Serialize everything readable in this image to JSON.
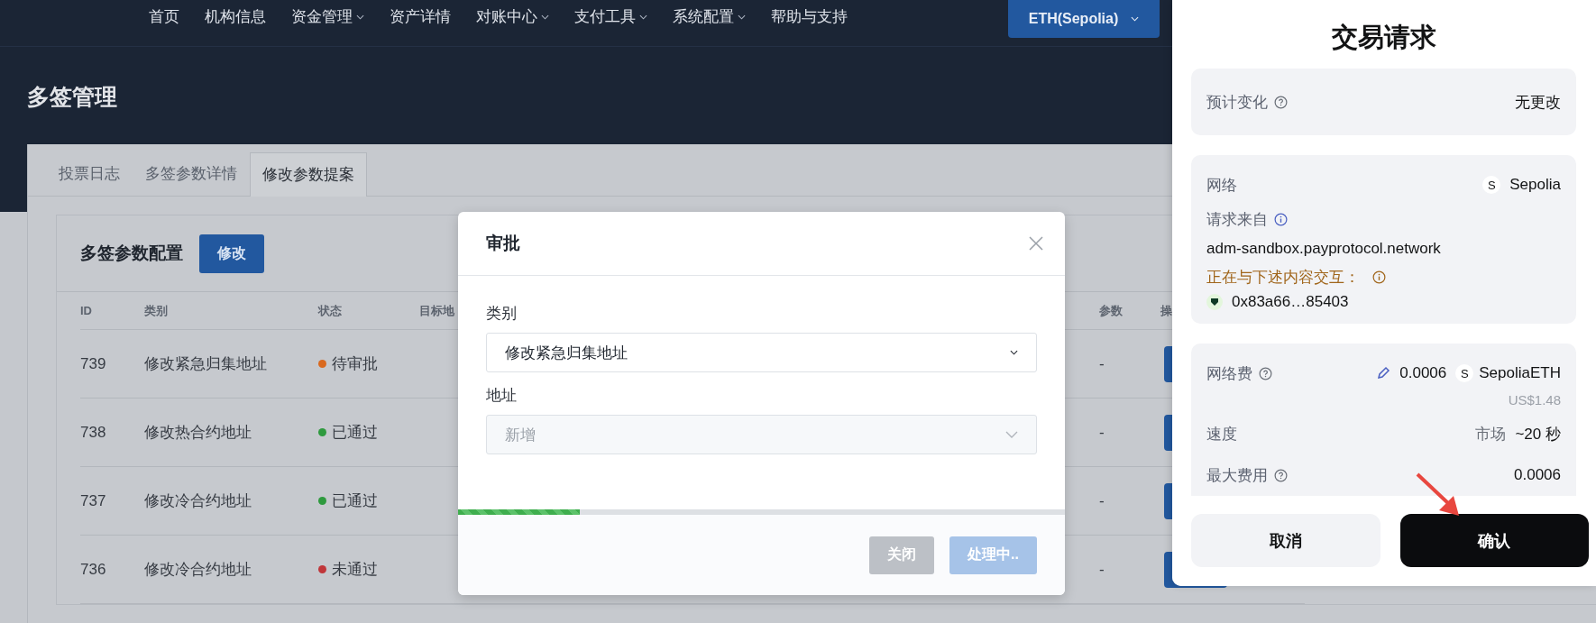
{
  "nav": {
    "items": [
      {
        "label": "首页",
        "dropdown": false
      },
      {
        "label": "机构信息",
        "dropdown": false
      },
      {
        "label": "资金管理",
        "dropdown": true
      },
      {
        "label": "资产详情",
        "dropdown": false
      },
      {
        "label": "对账中心",
        "dropdown": true
      },
      {
        "label": "支付工具",
        "dropdown": true
      },
      {
        "label": "系统配置",
        "dropdown": true
      },
      {
        "label": "帮助与支持",
        "dropdown": false
      }
    ],
    "network_button": "ETH(Sepolia)"
  },
  "page_title": "多签管理",
  "tabs": [
    {
      "label": "投票日志",
      "selected": false
    },
    {
      "label": "多签参数详情",
      "selected": false
    },
    {
      "label": "修改参数提案",
      "selected": true
    }
  ],
  "config_card": {
    "title": "多签参数配置",
    "edit_button": "修改"
  },
  "table": {
    "columns": [
      "ID",
      "类别",
      "状态",
      "目标地",
      "参数",
      "操"
    ],
    "rows": [
      {
        "id": "739",
        "category": "修改紧急归集地址",
        "status": "待审批",
        "color": "#d9691f",
        "params": "-"
      },
      {
        "id": "738",
        "category": "修改热合约地址",
        "status": "已通过",
        "color": "#2e9a3e",
        "params": "-"
      },
      {
        "id": "737",
        "category": "修改冷合约地址",
        "status": "已通过",
        "color": "#2e9a3e",
        "params": "-"
      },
      {
        "id": "736",
        "category": "修改冷合约地址",
        "status": "未通过",
        "color": "#c0363a",
        "params": "-"
      }
    ]
  },
  "modal": {
    "title": "审批",
    "fields": [
      {
        "label": "类别",
        "value": "修改紧急归集地址",
        "disabled": false
      },
      {
        "label": "地址",
        "placeholder": "新增",
        "disabled": true
      }
    ],
    "progress": {
      "level": 0.2
    },
    "buttons": [
      {
        "label": "关闭",
        "kind": "secondary",
        "disabled": true
      },
      {
        "label": "处理中..",
        "kind": "primary",
        "disabled": true
      }
    ]
  },
  "wallet": {
    "title": "交易请求",
    "estimated_changes": {
      "label": "预计变化",
      "value": "无更改"
    },
    "network": {
      "label": "网络",
      "badge": "S",
      "value": "Sepolia"
    },
    "request_from": {
      "label": "请求来自",
      "value": "adm-sandbox.payprotocol.network"
    },
    "interacting": {
      "label": "正在与下述内容交互：",
      "address": "0x83a66…85403"
    },
    "fee": {
      "label": "网络费",
      "amount": "0.0006",
      "badge": "S",
      "token": "SepoliaETH",
      "fiat": "US$1.48"
    },
    "speed": {
      "label": "速度",
      "mode": "市场",
      "time": "~20 秒"
    },
    "max_fee": {
      "label": "最大费用",
      "value": "0.0006"
    },
    "buttons": [
      {
        "label": "取消",
        "kind": "secondary"
      },
      {
        "label": "确认",
        "kind": "primary"
      }
    ]
  }
}
